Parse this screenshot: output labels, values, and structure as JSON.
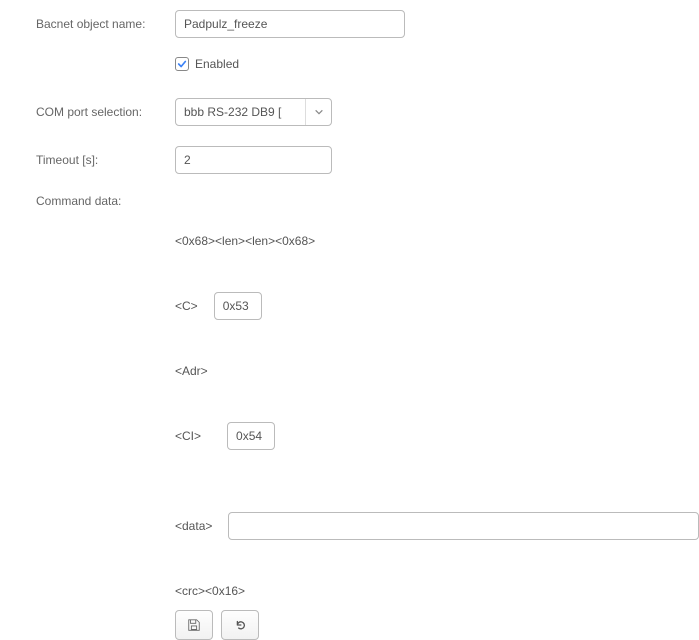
{
  "labels": {
    "bacnet_name": "Bacnet object name:",
    "enabled": "Enabled",
    "com_port": "COM port selection:",
    "timeout": "Timeout [s]:",
    "command_data": "Command data:"
  },
  "values": {
    "bacnet_name": "Padpulz_freeze",
    "enabled": true,
    "com_port": "bbb RS-232 DB9 [",
    "timeout": "2",
    "c_field": "0x53",
    "ci_field": "0x54",
    "data_field": ""
  },
  "command": {
    "header": "<0x68><len><len><0x68>",
    "c_label": "<C>",
    "adr_label": "<Adr>",
    "ci_label": "<CI>",
    "data_label": "<data>",
    "crc_label": "<crc><0x16>"
  },
  "colors": {
    "check": "#3b82f6",
    "icon": "#666"
  }
}
